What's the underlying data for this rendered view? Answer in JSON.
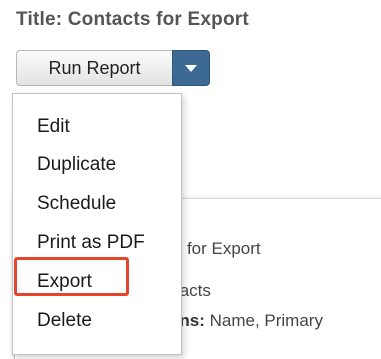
{
  "header": {
    "title": "Title: Contacts for Export"
  },
  "toolbar": {
    "run_label": "Run Report"
  },
  "menu": {
    "items": [
      {
        "label": "Edit"
      },
      {
        "label": "Duplicate"
      },
      {
        "label": "Schedule"
      },
      {
        "label": "Print as PDF"
      },
      {
        "label": "Export"
      },
      {
        "label": "Delete"
      }
    ]
  },
  "panel": {
    "line1": "ts for Export",
    "line2": "tacts",
    "line3_label": "nns:",
    "line3_value": " Name, Primary"
  },
  "colors": {
    "accent": "#3c6a94",
    "highlight": "#e8432c"
  },
  "icons": {
    "dropdown": "chevron-down-icon"
  }
}
